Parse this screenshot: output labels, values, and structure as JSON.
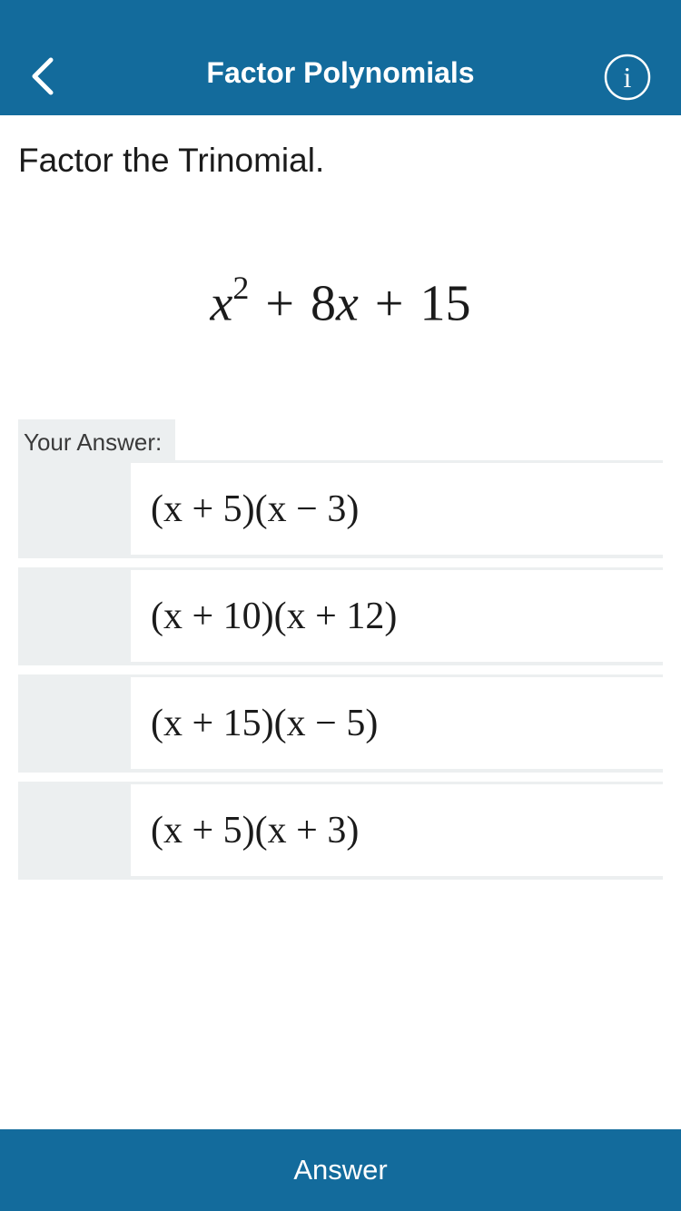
{
  "header": {
    "title": "Factor Polynomials",
    "back_icon": "chevron-left-icon",
    "info_icon": "info-icon",
    "background": "#136b9c"
  },
  "prompt": "Factor the Trinomial.",
  "equation": {
    "var": "x",
    "exponent": "2",
    "op1": "+",
    "term2": "8",
    "term2_var": "x",
    "op2": "+",
    "term3": "15"
  },
  "answer_label": "Your Answer:",
  "options": [
    {
      "label": "(x + 5)(x − 3)"
    },
    {
      "label": "(x + 10)(x + 12)"
    },
    {
      "label": "(x + 15)(x − 5)"
    },
    {
      "label": "(x + 5)(x + 3)"
    }
  ],
  "answer_button": "Answer"
}
